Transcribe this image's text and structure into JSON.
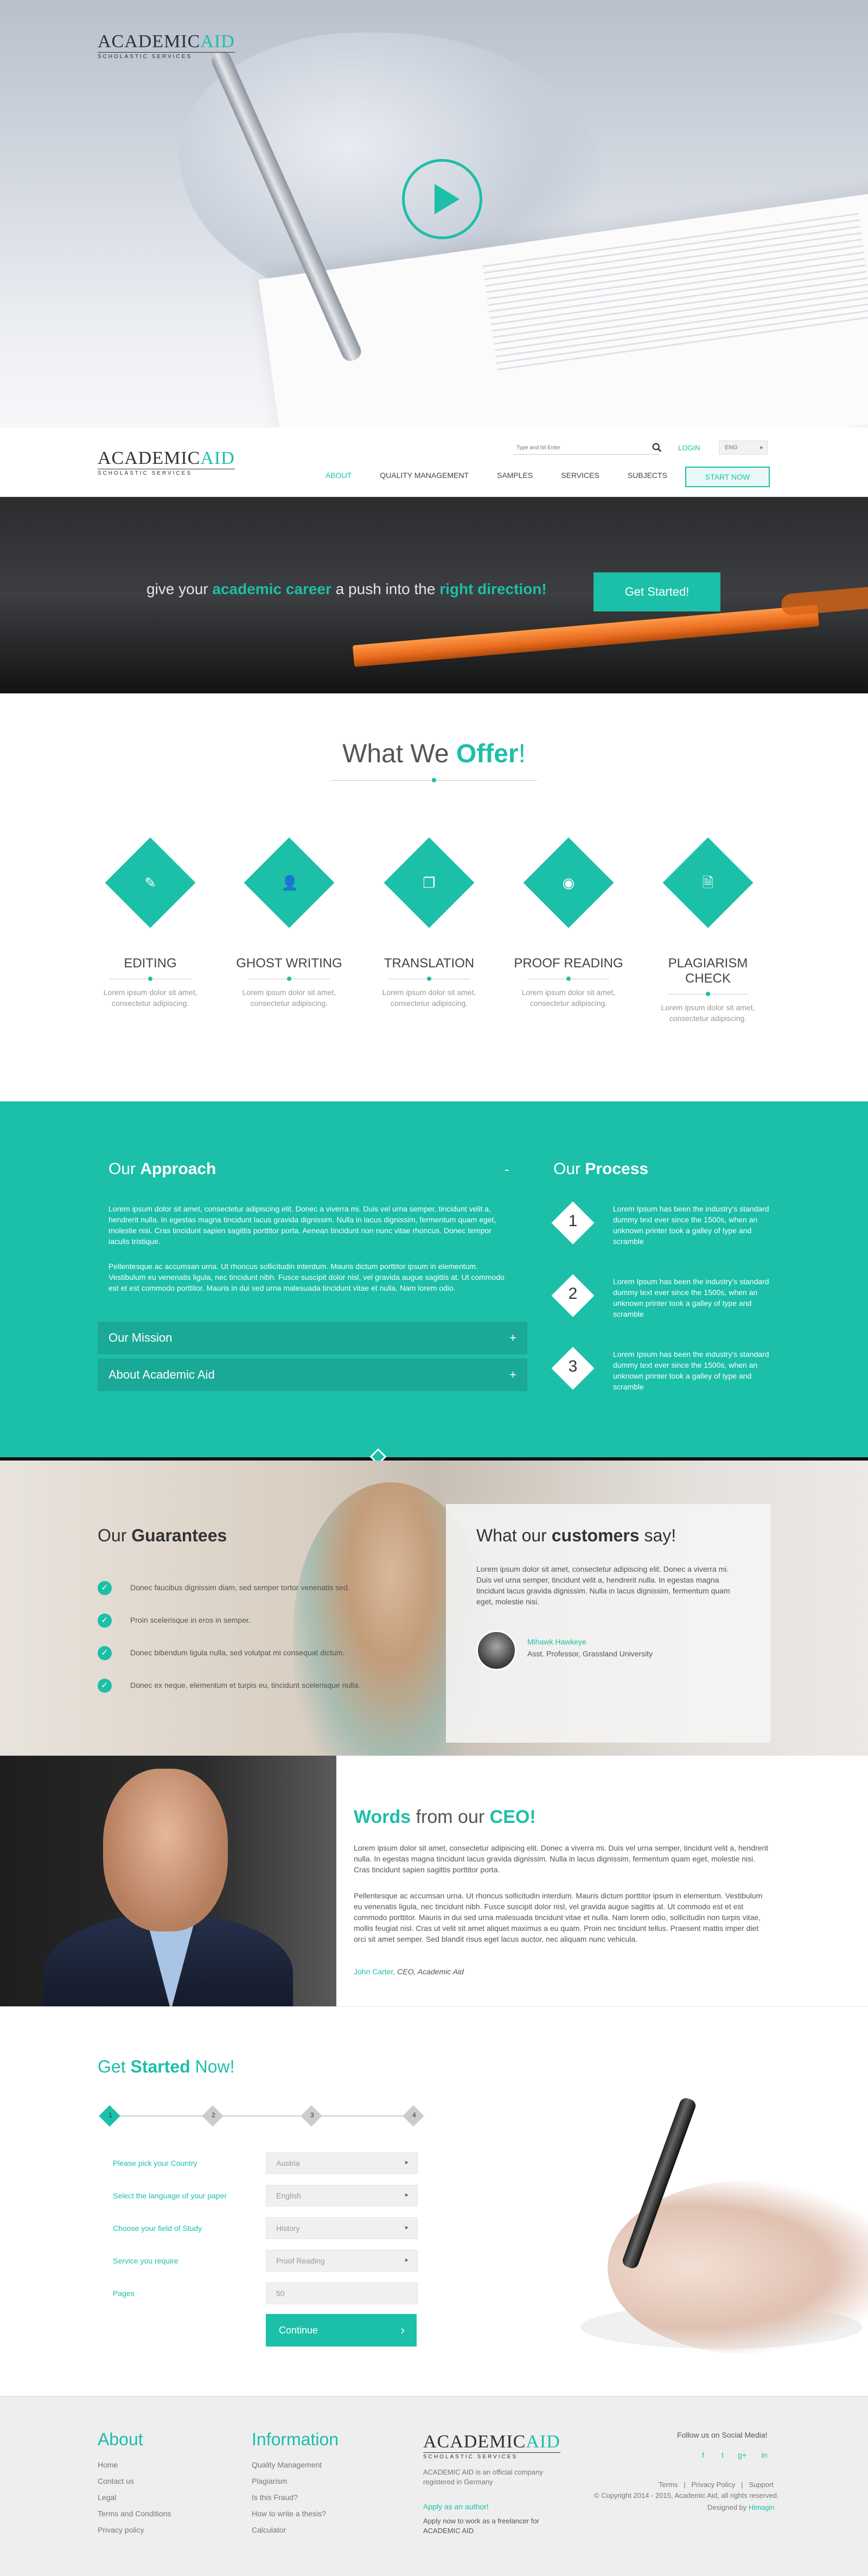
{
  "brand": {
    "name_part1": "ACADEMIC",
    "name_part2": "AID",
    "tagline": "SCHOLASTIC SERVICES"
  },
  "colors": {
    "accent": "#1cbfa8",
    "dark": "#2d3236",
    "footer_bg": "#eeeeee"
  },
  "hero": {
    "play_icon": "play-icon"
  },
  "nav": {
    "search_placeholder": "Type and hit Enter",
    "search_icon": "search-icon",
    "login": "LOGIN",
    "lang": "ENG",
    "items": [
      "ABOUT",
      "QUALITY MANAGEMENT",
      "SAMPLES",
      "SERVICES",
      "SUBJECTS"
    ],
    "active": "ABOUT",
    "cta": "START NOW"
  },
  "banner": {
    "t1": "give your ",
    "t2": "academic career",
    "t3": " a push into the ",
    "t4": "right direction!",
    "button": "Get Started!"
  },
  "offer": {
    "title_part1": "What We ",
    "title_part2": "Offer",
    "title_part3": "!",
    "services": [
      {
        "name": "EDITING",
        "icon": "edit-icon",
        "desc": "Lorem ipsum dolor sit amet, consectetur adipiscing."
      },
      {
        "name": "GHOST WRITING",
        "icon": "user-icon",
        "desc": "Lorem ipsum dolor sit amet, consectetur adipiscing."
      },
      {
        "name": "TRANSLATION",
        "icon": "copy-icon",
        "desc": "Lorem ipsum dolor sit amet, consectetur adipiscing."
      },
      {
        "name": "PROOF READING",
        "icon": "eye-icon",
        "desc": "Lorem ipsum dolor sit amet, consectetur adipiscing."
      },
      {
        "name": "PLAGIARISM CHECK",
        "icon": "document-search-icon",
        "desc": "Lorem ipsum dolor sit amet, consectetur adipiscing."
      }
    ]
  },
  "approach": {
    "title_part1": "Our ",
    "title_part2": "Approach",
    "toggle": "-",
    "p1": "Lorem ipsum dolor sit amet, consectetur adipiscing elit. Donec a viverra mi. Duis vel urna semper, tincidunt velit a, hendrerit nulla. In egestas magna tincidunt lacus gravida dignissim. Nulla in lacus dignissim, fermentum quam eget, molestie nisi. Cras tincidunt sapien sagittis porttitor porta. Aenean tincidunt non nunc vitae rhoncus. Donec tempor iaculis tristique.",
    "p2": "Pellentesque ac accumsan urna. Ut rhoncus sollicitudin interdum. Mauris dictum porttitor ipsum in elementum. Vestibulum eu venenatis ligula, nec tincidunt nibh. Fusce suscipit dolor nisl, vel gravida augue sagittis at. Ut commodo est et est commodo porttitor. Mauris in dui sed urna malesuada tincidunt vitae et nulla. Nam lorem odio.",
    "accordion": [
      {
        "label": "Our Mission",
        "icon": "+"
      },
      {
        "label": "About Academic Aid",
        "icon": "+"
      }
    ]
  },
  "process": {
    "title_part1": "Our ",
    "title_part2": "Process",
    "steps": [
      {
        "n": "1",
        "text": "Lorem Ipsum has been the industry's standard dummy text ever since the 1500s, when an unknown printer took a galley of type and scramble"
      },
      {
        "n": "2",
        "text": "Lorem Ipsum has been the industry's standard dummy text ever since the 1500s, when an unknown printer took a galley of type and scramble"
      },
      {
        "n": "3",
        "text": "Lorem Ipsum has been the industry's standard dummy text ever since the 1500s, when an unknown printer took a galley of type and scramble"
      }
    ]
  },
  "guarantees": {
    "title_part1": "Our ",
    "title_part2": "Guarantees",
    "items": [
      "Donec faucibus dignissim diam, sed semper tortor venenatis sed.",
      "Proin scelerisque in eros in semper.",
      "Donec bibendum ligula nulla, sed volutpat mi consequat dictum.",
      "Donec ex neque, elementum et turpis eu, tincidunt scelerisque nulla."
    ],
    "check_icon": "check-icon"
  },
  "testimonial": {
    "title_part1": "What our ",
    "title_part2": "customers",
    "title_part3": " say!",
    "text": "Lorem ipsum dolor sit amet, consectetur adipiscing elit. Donec a viverra mi. Duis vel urna semper, tincidunt velit a, hendrerit nulla. In egestas magna tincidunt lacus gravida dignissim. Nulla in lacus dignissim, fermentum quam eget, molestie nisi.",
    "name": "Mihawk Hawkeye",
    "role": "Asst. Professor, Grassland University"
  },
  "ceo": {
    "title_part1": "Words",
    "title_part2": " from our ",
    "title_part3": "CEO!",
    "p1": "Lorem ipsum dolor sit amet, consectetur adipiscing elit. Donec a viverra mi. Duis vel urna semper, tincidunt velit a, hendrerit nulla. In egestas magna tincidunt lacus gravida dignissim. Nulla in lacus dignissim, fermentum quam eget, molestie nisi. Cras tincidunt sapien sagittis porttitor porta.",
    "p2": "Pellentesque ac accumsan urna. Ut rhoncus sollicitudin interdum. Mauris dictum porttitor ipsum in elementum. Vestibulum eu venenatis ligula, nec tincidunt nibh. Fusce suscipit dolor nisl, vel gravida augue sagittis at. Ut commodo est et est commodo porttitor. Mauris in dui sed urna malesuada tincidunt vitae et nulla. Nam lorem odio, sollicitudin non turpis vitae, mollis feugiat nisl. Cras ut velit sit amet aliquet maximus a eu quam. Proin nec tincidunt tellus. Praesent mattis imper diet orci sit amet semper. Sed blandit risus eget lacus auctor, nec aliquam nunc vehicula.",
    "sig_name": "John Carter,",
    "sig_role": " CEO, Academic Aid"
  },
  "get_started": {
    "title_part1": "Get ",
    "title_part2": "Started",
    "title_part3": " Now!",
    "steps": [
      "1",
      "2",
      "3",
      "4"
    ],
    "current_step": 1,
    "fields": [
      {
        "label": "Please pick your Country",
        "value": "Austria"
      },
      {
        "label": "Select the language of your paper",
        "value": "English"
      },
      {
        "label": "Choose your field of Study",
        "value": "History"
      },
      {
        "label": "Service you require",
        "value": "Proof Reading"
      },
      {
        "label": "Pages",
        "value": "50"
      }
    ],
    "continue": "Continue"
  },
  "footer": {
    "about_title": "About",
    "about_links": [
      "Home",
      "Contact us",
      "Legal",
      "Terms and Conditions",
      "Privacy policy"
    ],
    "info_title": "Information",
    "info_links": [
      "Quality Management",
      "Plagiarism",
      "Is this Fraud?",
      "How to write a thesis?",
      "Calculator"
    ],
    "desc": "ACADEMIC AID is an official company registered in Germany",
    "apply": "Apply as an author!",
    "apply_text": "Apply now to work as a freelancer for ACADEMIC AID",
    "follow": "Follow us on Social Media!",
    "social": [
      "facebook-icon",
      "twitter-icon",
      "google-plus-icon",
      "linkedin-icon"
    ],
    "links": "Terms   |   Privacy Policy   |   Support",
    "copyright": "© Copyright 2014 - 2015, Academic Aid, all rights reserved.",
    "designed_by": "Designed by ",
    "designer": "Himagin"
  }
}
